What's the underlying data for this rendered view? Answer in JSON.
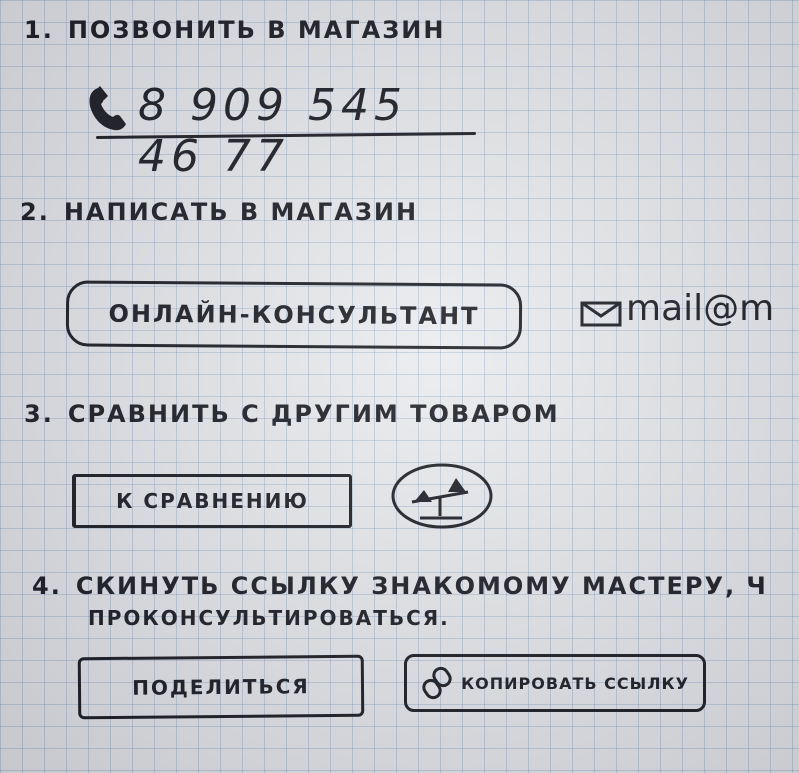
{
  "sections": {
    "call": {
      "number": "1.",
      "title": "позвонить в магазин",
      "phone": "8 909 545 46 77"
    },
    "write": {
      "number": "2.",
      "title": "написать в магазин",
      "consultant_button": "онлайн-консультант",
      "mail_label": "mail@m"
    },
    "compare": {
      "number": "3.",
      "title": "сравнить с другим товаром",
      "compare_button": "к сравнению"
    },
    "share": {
      "number": "4.",
      "title_line1": "скинуть ссылку знакомому мастеру, ч",
      "title_line2": "проконсультироваться.",
      "share_button": "поделиться",
      "copy_link_button": "копировать ссылку"
    }
  },
  "icons": {
    "phone": "phone-icon",
    "mail": "envelope-icon",
    "compare": "scales-icon",
    "link": "link-icon"
  },
  "colors": {
    "ink": "#15161d",
    "paper": "#e9ebee",
    "grid": "#7896be"
  }
}
